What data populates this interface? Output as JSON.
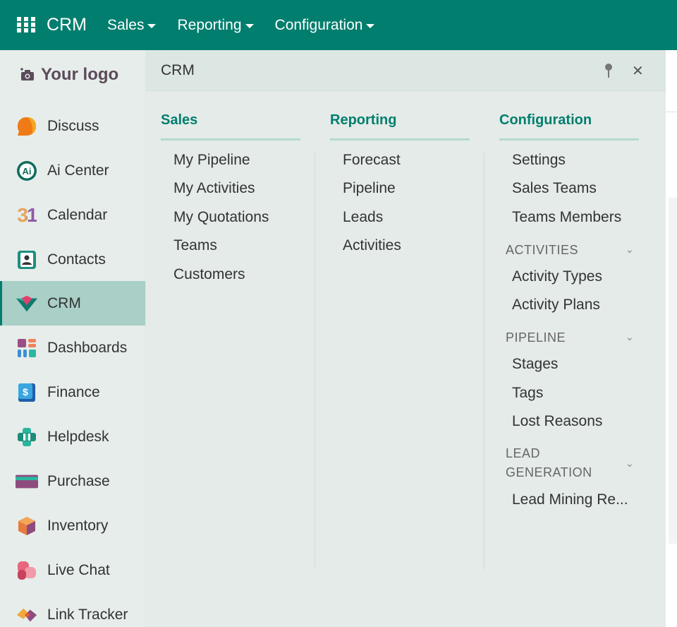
{
  "topbar": {
    "brand": "CRM",
    "nav": [
      {
        "label": "Sales"
      },
      {
        "label": "Reporting"
      },
      {
        "label": "Configuration"
      }
    ]
  },
  "sidebar": {
    "logo_text": "Your logo",
    "items": [
      {
        "label": "Discuss",
        "icon": "discuss-icon"
      },
      {
        "label": "Ai Center",
        "icon": "ai-center-icon"
      },
      {
        "label": "Calendar",
        "icon": "calendar-icon"
      },
      {
        "label": "Contacts",
        "icon": "contacts-icon"
      },
      {
        "label": "CRM",
        "icon": "crm-icon",
        "active": true
      },
      {
        "label": "Dashboards",
        "icon": "dashboards-icon"
      },
      {
        "label": "Finance",
        "icon": "finance-icon"
      },
      {
        "label": "Helpdesk",
        "icon": "helpdesk-icon"
      },
      {
        "label": "Purchase",
        "icon": "purchase-icon"
      },
      {
        "label": "Inventory",
        "icon": "inventory-icon"
      },
      {
        "label": "Live Chat",
        "icon": "live-chat-icon"
      },
      {
        "label": "Link Tracker",
        "icon": "link-tracker-icon"
      }
    ],
    "calendar_day": "31"
  },
  "panel": {
    "title": "CRM",
    "columns": {
      "sales": {
        "heading": "Sales",
        "items": [
          "My Pipeline",
          "My Activities",
          "My Quotations",
          "Teams",
          "Customers"
        ]
      },
      "reporting": {
        "heading": "Reporting",
        "items": [
          "Forecast",
          "Pipeline",
          "Leads",
          "Activities"
        ]
      },
      "configuration": {
        "heading": "Configuration",
        "items": [
          "Settings",
          "Sales Teams",
          "Teams Members"
        ],
        "sections": [
          {
            "heading": "ACTIVITIES",
            "items": [
              "Activity Types",
              "Activity Plans"
            ]
          },
          {
            "heading": "PIPELINE",
            "items": [
              "Stages",
              "Tags",
              "Lost Reasons"
            ]
          },
          {
            "heading_line1": "LEAD",
            "heading_line2": "GENERATION",
            "items": [
              "Lead Mining Re..."
            ]
          }
        ]
      }
    }
  },
  "colors": {
    "brand": "#017E6E",
    "active_item": "#A9CFC7",
    "sidebar_bg": "#E6EDEA",
    "panel_bg": "#E4EBE8"
  }
}
